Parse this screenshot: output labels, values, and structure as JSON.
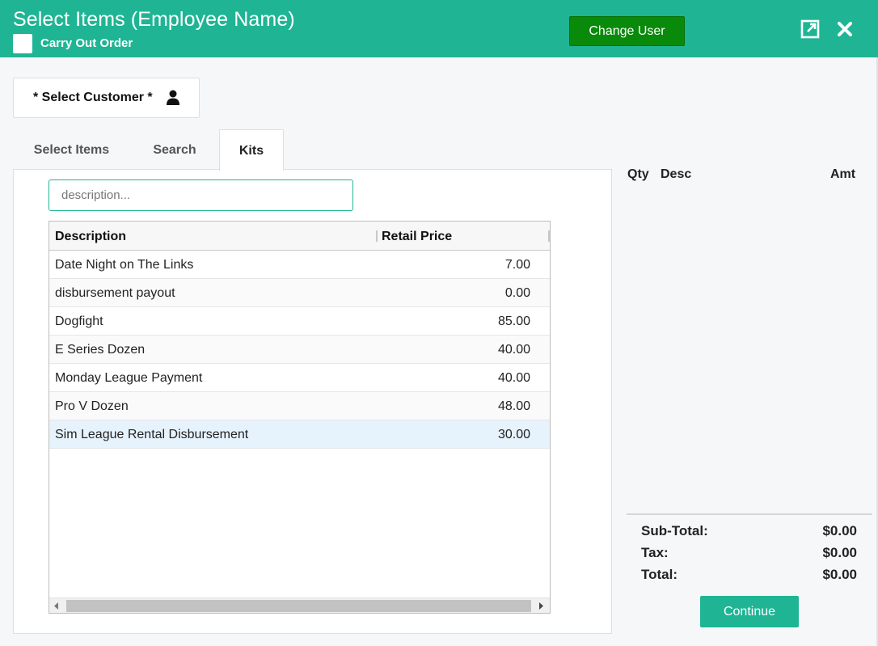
{
  "header": {
    "title": "Select Items (Employee Name)",
    "carry_out_label": "Carry Out Order",
    "change_user_label": "Change User",
    "accent_color": "#1fb594"
  },
  "customer": {
    "select_label": "* Select Customer *"
  },
  "tabs": [
    {
      "label": "Select Items",
      "active": false
    },
    {
      "label": "Search",
      "active": false
    },
    {
      "label": "Kits",
      "active": true
    }
  ],
  "search": {
    "placeholder": "description..."
  },
  "grid": {
    "columns": [
      "Description",
      "Retail Price"
    ],
    "rows": [
      {
        "description": "Date Night on The Links",
        "price": "7.00"
      },
      {
        "description": "disbursement payout",
        "price": "0.00"
      },
      {
        "description": "Dogfight",
        "price": "85.00"
      },
      {
        "description": "E Series Dozen",
        "price": "40.00"
      },
      {
        "description": "Monday League Payment",
        "price": "40.00"
      },
      {
        "description": "Pro V Dozen",
        "price": "48.00"
      },
      {
        "description": "Sim League Rental Disbursement",
        "price": "30.00",
        "selected": true
      }
    ]
  },
  "cart": {
    "headers": {
      "qty": "Qty",
      "desc": "Desc",
      "amt": "Amt"
    },
    "subtotal_label": "Sub-Total:",
    "subtotal_value": "$0.00",
    "tax_label": "Tax:",
    "tax_value": "$0.00",
    "total_label": "Total:",
    "total_value": "$0.00",
    "continue_label": "Continue"
  }
}
